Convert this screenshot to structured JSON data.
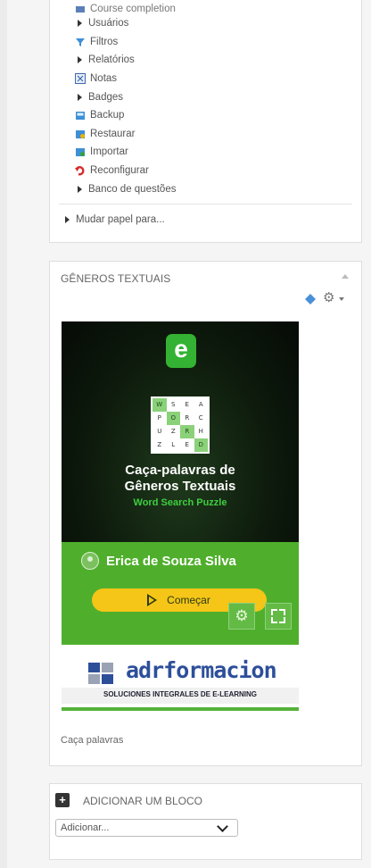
{
  "admin": {
    "items": [
      {
        "label": "Course completion",
        "icon": "completion-icon"
      },
      {
        "label": "Usuários",
        "icon": "expand-arrow-icon"
      },
      {
        "label": "Filtros",
        "icon": "filter-icon"
      },
      {
        "label": "Relatórios",
        "icon": "expand-arrow-icon"
      },
      {
        "label": "Notas",
        "icon": "grades-icon"
      },
      {
        "label": "Badges",
        "icon": "expand-arrow-icon"
      },
      {
        "label": "Backup",
        "icon": "backup-icon"
      },
      {
        "label": "Restaurar",
        "icon": "restore-icon"
      },
      {
        "label": "Importar",
        "icon": "import-icon"
      },
      {
        "label": "Reconfigurar",
        "icon": "reset-icon"
      },
      {
        "label": "Banco de questões",
        "icon": "expand-arrow-icon"
      }
    ],
    "switch_role": "Mudar papel para..."
  },
  "genres_block": {
    "title": "GÊNEROS TEXTUAIS",
    "game": {
      "grid_letters": [
        "W",
        "S",
        "E",
        "A",
        "P",
        "O",
        "R",
        "C",
        "U",
        "Z",
        "R",
        "H",
        "Z",
        "L",
        "E",
        "D"
      ],
      "title_line1": "Caça-palavras de",
      "title_line2": "Gêneros Textuais",
      "subtitle": "Word Search Puzzle",
      "user_name": "Erica de Souza Silva",
      "start_label": "Começar"
    },
    "sponsor": {
      "name": "adrformacion",
      "tagline": "SOLUCIONES INTEGRALES DE E-LEARNING"
    },
    "caption": "Caça palavras"
  },
  "add_block": {
    "title": "ADICIONAR UM BLOCO",
    "select_value": "Adicionar..."
  },
  "colors": {
    "brand_green": "#4faf2c",
    "start_yellow": "#f5c518",
    "adr_blue": "#2d4f9a"
  }
}
